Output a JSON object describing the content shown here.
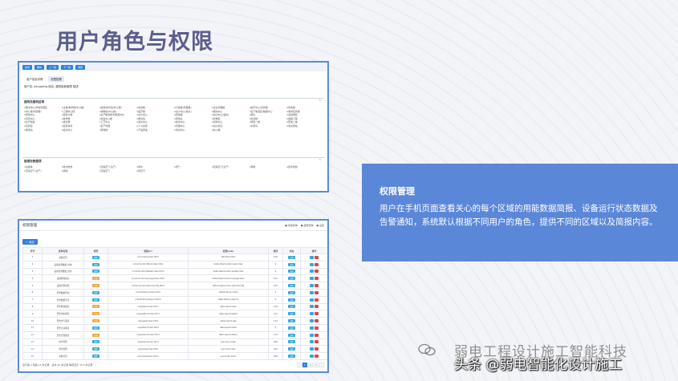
{
  "slide": {
    "title": "用户角色与权限"
  },
  "info": {
    "title": "权限管理",
    "body": "用户在手机页面查看关心的每个区域的用能数据简报、设备运行状态数据及告警通知，系统默认根据不同用户的角色，提供不同的区域以及简报内容。"
  },
  "shot1": {
    "top_buttons": [
      "新增",
      "删除",
      "上一级",
      "下一级",
      "保存"
    ],
    "tabs": [
      "用户信息详情",
      "权限配置"
    ],
    "user_line": "用户名: jiangpeng   库名: 建筑能耗管理  描述:",
    "section1_title": "建筑及建筑区域",
    "section1_items": [
      "图书中心/学校管理区",
      "主楼/教学楼(中心楼)",
      "后勤/体育馆(护士楼)",
      "综合楼",
      "行政楼(管理楼)",
      "企业管理楼",
      "医疗中心/实验楼",
      "综合楼",
      "中心楼(科研楼)",
      "工程中心楼",
      "博物馆(中心楼)",
      "医疗楼",
      "动力中心(机房)",
      "图书中心",
      "生产制造区/数据中心",
      "教学实验楼",
      "研发中心",
      "综合大楼",
      "生产制造楼/新能源中心",
      "动力中心",
      "研发楼",
      "动力中心(临时)",
      "库房",
      "后勤保障",
      "实验中心",
      "教学楼",
      "综合办公楼",
      "图书馆",
      "配电房",
      "配电室",
      "综合楼",
      "数据工程",
      "生产制造",
      "重点楼",
      "工艺中心",
      "会议中心",
      "技术中心",
      "创新中心",
      "研发一楼",
      "研发二楼",
      "实验室",
      "装配车间",
      "生产管理",
      "人力资源",
      "管理中心",
      "动力机房",
      "水泵房",
      "热交换站",
      "能源站",
      "会议中心",
      "研发楼",
      "产品研发",
      "测试中心",
      "办公楼"
    ],
    "section2_title": "能源及数据项",
    "section2_items": [
      "总能耗",
      "集中供热",
      "压缩空气(生产)",
      "用水",
      "燃气",
      "压缩空气(生产)",
      "用电",
      "集中供热",
      "压缩空气(生产)",
      "供暖",
      "压缩空气",
      "用蒸汽"
    ]
  },
  "shot2": {
    "title": "权限管理",
    "legend": [
      "● 添加菜单",
      "● 权限管理",
      "● 设置"
    ],
    "add_button": "+ 添加",
    "columns": [
      "序号",
      "菜单名称",
      "类型",
      "链接url",
      "权限code",
      "排序",
      "状态",
      "操作"
    ],
    "rows": [
      {
        "no": "1",
        "name": "系统首页",
        "type": "菜单",
        "url": "/pc/index/index.html",
        "code": "sfsf:sfsf:index",
        "sort": "100",
        "status": "启用"
      },
      {
        "no": "2",
        "name": "设备监测数据_用电",
        "type": "菜单",
        "url": "/cms/monitor/ElecIndex.html",
        "code": "data:datamonitor:elecIndex",
        "sort": "0",
        "status": "启用"
      },
      {
        "no": "3",
        "name": "设备监测数据_用水",
        "type": "菜单",
        "url": "/cms/monitor/WaterIndex.html",
        "code": "data:datamonitor:waterIndex",
        "sort": "0",
        "status": "启用"
      },
      {
        "no": "4",
        "name": "设备能耗指标",
        "type": "目录",
        "url": "/cms/monitor/energyIndex.html",
        "code": "data:datamonitor:energyIndex",
        "sort": "101",
        "status": "启用"
      },
      {
        "no": "5",
        "name": "设备告警配置",
        "type": "目录",
        "url": "/cms/monitor/alarmConfig.html",
        "code": "data:datamonitor:alarmConfig",
        "sort": "102",
        "status": "启用"
      },
      {
        "no": "6",
        "name": "历史数据查询",
        "type": "菜单",
        "url": "/cms/history/index.html",
        "code": "data:history:index",
        "sort": "0",
        "status": "启用"
      },
      {
        "no": "7",
        "name": "历史数据导出",
        "type": "菜单",
        "url": "/cms/history/export.html",
        "code": "data:history:export",
        "sort": "0",
        "status": "启用"
      },
      {
        "no": "8",
        "name": "历史能耗报表",
        "type": "目录",
        "url": "/rep/elec/index.html",
        "code": "data:report:elec",
        "sort": "110",
        "status": "启用"
      },
      {
        "no": "9",
        "name": "历史用水报表",
        "type": "目录",
        "url": "/rep/water/index.html",
        "code": "data:report:water",
        "sort": "111",
        "status": "启用"
      },
      {
        "no": "10",
        "name": "历史用气报表",
        "type": "目录",
        "url": "/rep/gas/index.html",
        "code": "data:report:gas",
        "sort": "112",
        "status": "启用"
      },
      {
        "no": "11",
        "name": "历史分项报表",
        "type": "菜单",
        "url": "/rep/item/index.html",
        "code": "data:report:item",
        "sort": "0",
        "status": "启用"
      },
      {
        "no": "12",
        "name": "历史告警报表",
        "type": "目录",
        "url": "/rep/alarm/index.html",
        "code": "data:report:alarm",
        "sort": "113",
        "status": "启用"
      },
      {
        "no": "13",
        "name": "用户管理",
        "type": "菜单",
        "url": "/sys/user/index.html",
        "code": "sys:user:index",
        "sort": "200",
        "status": "启用"
      },
      {
        "no": "14",
        "name": "角色管理",
        "type": "菜单",
        "url": "/sys/role/index.html",
        "code": "sys:role:index",
        "sort": "201",
        "status": "启用"
      },
      {
        "no": "15",
        "name": "系统首页",
        "type": "菜单",
        "url": "/pc/index/main.html",
        "code": "sys:index:main",
        "sort": "300",
        "status": "启用"
      }
    ],
    "footer": "显示第 1 到第 15 条记录，总共 44 条记录 每页显示 15 ▾ 条记录",
    "pages": [
      "‹",
      "1",
      "2",
      "3",
      "›"
    ]
  },
  "watermark": {
    "line1": "弱电工程设计施工智能科技",
    "line2": "头条 @弱电智能化设计施工"
  },
  "colors": {
    "title": "#5b5d8c",
    "info_bg": "#5b87d9",
    "frame": "#5b8bd4",
    "primary": "#2f7fe0"
  }
}
